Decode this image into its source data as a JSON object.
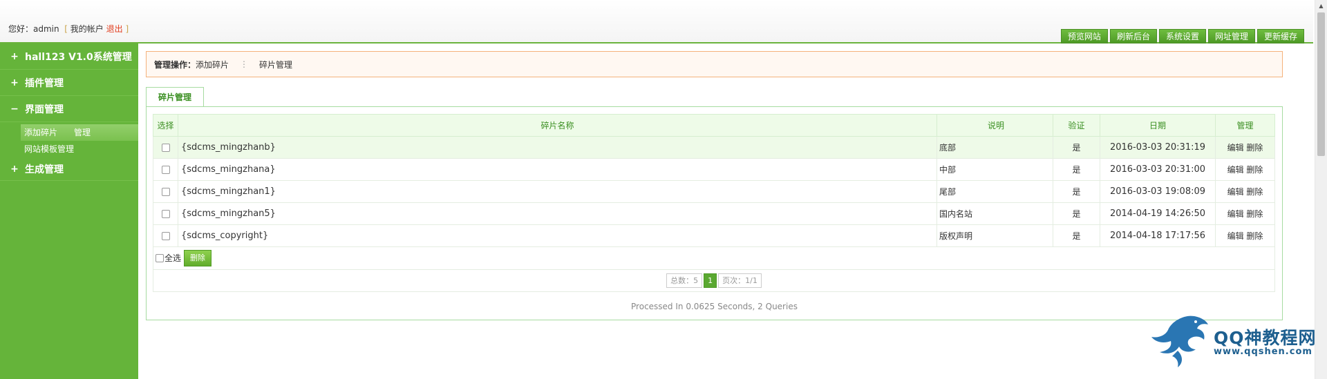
{
  "header": {
    "greeting_prefix": "您好：",
    "username": "admin",
    "bracket_open": "[",
    "my_account": "我的帐户",
    "logout": "退出",
    "bracket_close": "]",
    "nav": [
      "预览网站",
      "刷新后台",
      "系统设置",
      "网址管理",
      "更新缓存"
    ]
  },
  "sidebar": {
    "sections": [
      {
        "sign": "+",
        "label": "hall123 V1.0系统管理"
      },
      {
        "sign": "+",
        "label": "插件管理"
      },
      {
        "sign": "−",
        "label": "界面管理"
      },
      {
        "sign": "+",
        "label": "生成管理"
      }
    ],
    "sub_items": [
      {
        "label": "添加碎片",
        "extra": "管理"
      },
      {
        "label": "网站模板管理"
      }
    ]
  },
  "ops": {
    "label": "管理操作：",
    "add_link": "添加碎片",
    "separator": "⋮",
    "manage_link": "碎片管理"
  },
  "tab": {
    "label": "碎片管理"
  },
  "table": {
    "headers": {
      "select": "选择",
      "name": "碎片名称",
      "desc": "说明",
      "verify": "验证",
      "date": "日期",
      "manage": "管理"
    },
    "rows": [
      {
        "name": "{sdcms_mingzhanb}",
        "desc": "底部",
        "verify": "是",
        "date": "2016-03-03 20:31:19",
        "edit": "编辑",
        "delete": "删除"
      },
      {
        "name": "{sdcms_mingzhana}",
        "desc": "中部",
        "verify": "是",
        "date": "2016-03-03 20:31:00",
        "edit": "编辑",
        "delete": "删除"
      },
      {
        "name": "{sdcms_mingzhan1}",
        "desc": "尾部",
        "verify": "是",
        "date": "2016-03-03 19:08:09",
        "edit": "编辑",
        "delete": "删除"
      },
      {
        "name": "{sdcms_mingzhan5}",
        "desc": "国内名站",
        "verify": "是",
        "date": "2014-04-19 14:26:50",
        "edit": "编辑",
        "delete": "删除"
      },
      {
        "name": "{sdcms_copyright}",
        "desc": "版权声明",
        "verify": "是",
        "date": "2014-04-18 17:17:56",
        "edit": "编辑",
        "delete": "删除"
      }
    ]
  },
  "footer": {
    "select_all": "全选",
    "delete_button": "删除",
    "pager": {
      "total": "总数：5",
      "current": "1",
      "pages": "页次：1/1"
    },
    "processed": "Processed In 0.0625 Seconds, 2 Queries"
  },
  "watermark": {
    "text": "QQ神教程网",
    "url": "www.qqshen.com"
  },
  "colors": {
    "accent": "#65b43a",
    "logout": "#e23c1d",
    "header_text": "#3a8f21",
    "ops_border": "#f4b27b"
  }
}
